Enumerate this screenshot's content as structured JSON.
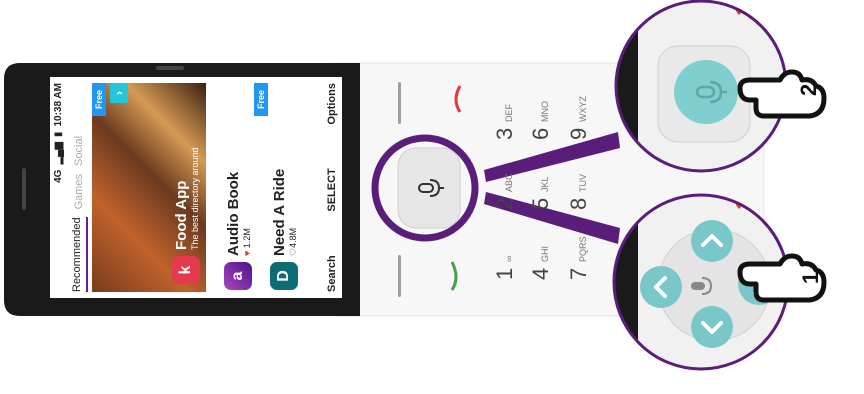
{
  "status_bar": {
    "network": "4G",
    "time": "10:38 AM"
  },
  "tabs": [
    {
      "label": "Recommended",
      "active": true
    },
    {
      "label": "Games",
      "active": false
    },
    {
      "label": "Social",
      "active": false
    }
  ],
  "banner_app": {
    "name": "Food App",
    "description": "The best directory around",
    "badge": "Free",
    "icon_letter": "k"
  },
  "apps": [
    {
      "name": "Audio Book",
      "stat": "1.2M",
      "icon_letter": "a",
      "badge": ""
    },
    {
      "name": "Need A Ride",
      "stat": "4.8M",
      "icon_letter": "D",
      "badge": "Free"
    }
  ],
  "softkeys": {
    "left": "Search",
    "center": "SELECT",
    "right": "Options"
  },
  "keypad": [
    {
      "digit": "1",
      "letters": "∞"
    },
    {
      "digit": "2",
      "letters": "ABC"
    },
    {
      "digit": "3",
      "letters": "DEF"
    },
    {
      "digit": "4",
      "letters": "GHI"
    },
    {
      "digit": "5",
      "letters": "JKL"
    },
    {
      "digit": "6",
      "letters": "MNO"
    },
    {
      "digit": "7",
      "letters": "PQRS"
    },
    {
      "digit": "8",
      "letters": "TUV"
    },
    {
      "digit": "9",
      "letters": "WXYZ"
    }
  ],
  "callouts": {
    "step1": "1",
    "step2": "2"
  },
  "colors": {
    "purple": "#5b1d7a",
    "teal": "#7fcfd0",
    "dpad": "#79c7c9",
    "red": "#e53935",
    "green": "#43a047"
  },
  "icons": [
    "mic-icon",
    "pointing-hand-icon",
    "chevron-up-icon",
    "chevron-down-icon",
    "chevron-left-icon",
    "chevron-right-icon",
    "heart-icon"
  ]
}
